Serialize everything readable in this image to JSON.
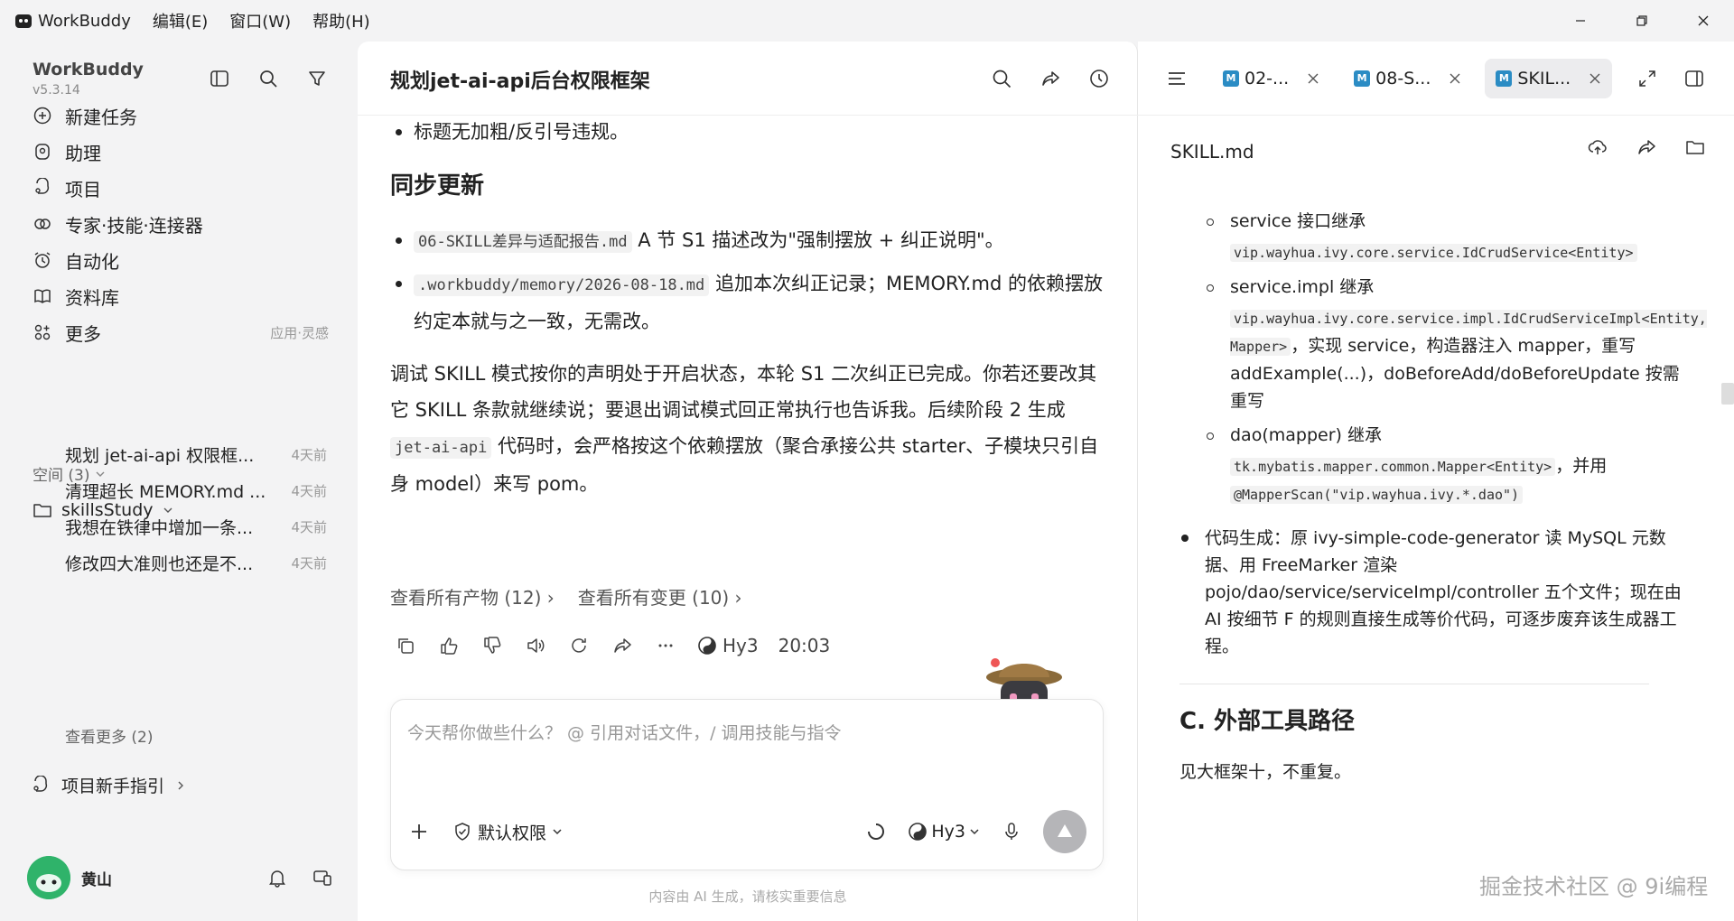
{
  "titlebar": {
    "app_name": "WorkBuddy",
    "menus": [
      "编辑(E)",
      "窗口(W)",
      "帮助(H)"
    ]
  },
  "sidebar": {
    "brand": "WorkBuddy",
    "version": "v5.3.14",
    "nav": [
      {
        "label": "新建任务",
        "icon": "new-task-icon"
      },
      {
        "label": "助理",
        "icon": "assistant-icon"
      },
      {
        "label": "项目",
        "icon": "project-icon"
      },
      {
        "label": "专家·技能·连接器",
        "icon": "expert-icon"
      },
      {
        "label": "自动化",
        "icon": "automation-icon"
      },
      {
        "label": "资料库",
        "icon": "library-icon"
      },
      {
        "label": "更多",
        "icon": "more-icon",
        "hint": "应用·灵感"
      }
    ],
    "space_label": "空间 (3)",
    "folder": "skillsStudy",
    "conversations": [
      {
        "title": "规划 jet-ai-api 权限框...",
        "time": "4天前"
      },
      {
        "title": "清理超长 MEMORY.md ...",
        "time": "4天前"
      },
      {
        "title": "我想在铁律中增加一条...",
        "time": "4天前"
      },
      {
        "title": "修改四大准则也还是不...",
        "time": "4天前"
      }
    ],
    "see_more": "查看更多 (2)",
    "guide": "项目新手指引",
    "user_name": "黄山"
  },
  "main": {
    "title": "规划jet-ai-api后台权限框架",
    "bullet_top": "标题无加粗/反引号违规。",
    "heading": "同步更新",
    "item1_code": "06-SKILL差异与适配报告.md",
    "item1_text": " A 节 S1 描述改为\"强制摆放 + 纠正说明\"。",
    "item2_code": ".workbuddy/memory/2026-08-18.md",
    "item2_text": " 追加本次纠正记录；MEMORY.md 的依赖摆放约定本就与之一致，无需改。",
    "para_a": "调试 SKILL 模式按你的声明处于开启状态，本轮 S1 二次纠正已完成。你若还要改其它 SKILL 条款就继续说；要退出调试模式回正常执行也告诉我。后续阶段 2 生成 ",
    "para_code": "jet-ai-api",
    "para_b": " 代码时，会严格按这个依赖摆放（聚合承接公共 starter、子模块只引自身 model）来写 pom。",
    "link_artifacts": "查看所有产物 (12)",
    "link_changes": "查看所有变更 (10)",
    "model": "Hy3",
    "time": "20:03",
    "placeholder": "今天帮你做些什么？  @ 引用对话文件，/ 调用技能与指令",
    "permission": "默认权限",
    "composer_model": "Hy3",
    "footer": "内容由 AI 生成，请核实重要信息"
  },
  "right": {
    "tabs": [
      "02-...",
      "08-S...",
      "SKIL..."
    ],
    "file_name": "SKILL.md",
    "svc_label": "service 接口继承",
    "svc_code": "vip.wayhua.ivy.core.service.IdCrudService<Entity>",
    "impl_label": "service.impl 继承",
    "impl_code": "vip.wayhua.ivy.core.service.impl.IdCrudServiceImpl<Entity, Mapper>",
    "impl_text": "，实现 service，构造器注入 mapper，重写 addExample(...)，doBeforeAdd/doBeforeUpdate 按需重写",
    "dao_label": "dao(mapper) 继承",
    "dao_code": "tk.mybatis.mapper.common.Mapper<Entity>",
    "dao_mid": "，并用 ",
    "dao_code2": "@MapperScan(\"vip.wayhua.ivy.*.dao\")",
    "codegen": "代码生成：原 ivy-simple-code-generator 读 MySQL 元数据、用 FreeMarker 渲染 pojo/dao/service/serviceImpl/controller 五个文件；现在由 AI 按细节 F 的规则直接生成等价代码，可逐步废弃该生成器工程。",
    "section_c": "C. 外部工具路径",
    "section_c_text": "见大框架十，不重复。"
  },
  "watermark": "掘金技术社区 @ 9i编程",
  "colors": {
    "accent": "#2b8cc4",
    "send": "#b5b5b8",
    "avatar": "#2fb36a"
  }
}
